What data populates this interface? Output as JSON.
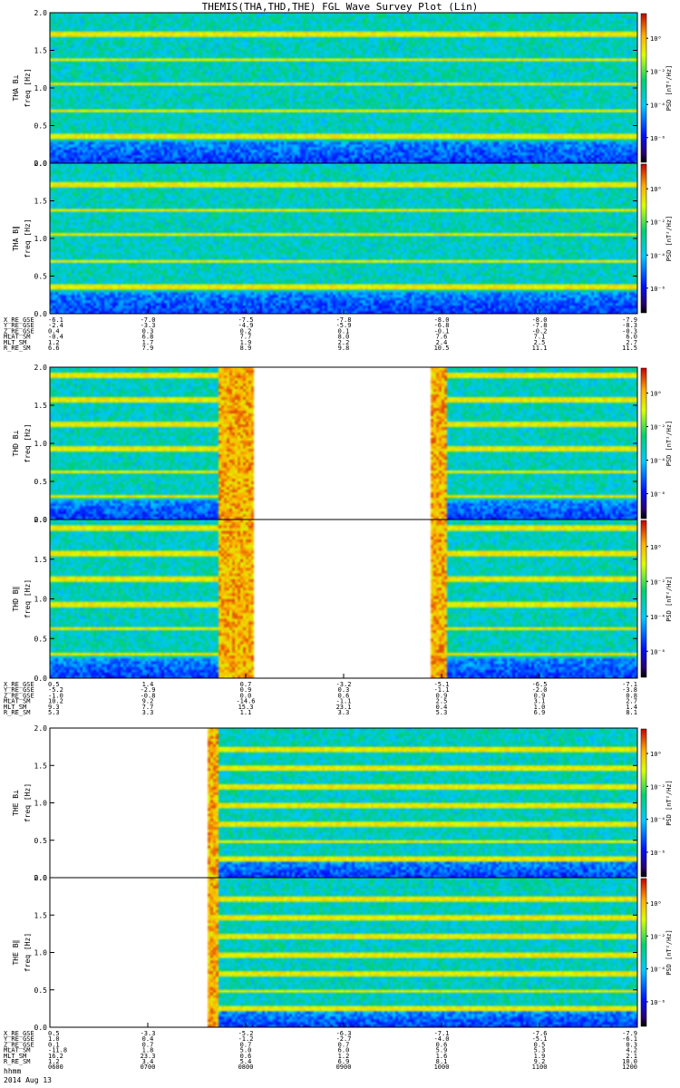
{
  "title": "THEMIS(THA,THD,THE) FGL Wave Survey Plot (Lin)",
  "colorbar_label": "PSD [nT²/Hz]",
  "colorbar_ticks": [
    "10⁰",
    "10⁻²",
    "10⁻⁴",
    "10⁻⁶"
  ],
  "freq_ticks": [
    "0.0",
    "0.5",
    "1.0",
    "1.5",
    "2.0"
  ],
  "footer": {
    "label": "hhmm",
    "date": "2014 Aug 13"
  },
  "chart_data": [
    {
      "type": "heatmap",
      "probe": "THA",
      "ylim": [
        0,
        2.0
      ],
      "panels": [
        {
          "label": "THA B⊥",
          "ylabel": "freq [Hz]",
          "bands": [
            0.35,
            0.7,
            1.05,
            1.38,
            1.72
          ],
          "lowfreq_cut": 0.3,
          "data_gaps": []
        },
        {
          "label": "THA B∥",
          "ylabel": "freq [Hz]",
          "bands": [
            0.35,
            0.7,
            1.05,
            1.38,
            1.72
          ],
          "lowfreq_cut": 0.3,
          "data_gaps": []
        }
      ],
      "ephemeris": [
        {
          "name": "X_RE_GSE",
          "values": [
            "-6.1",
            "-7.0",
            "-7.5",
            "-7.8",
            "-8.0",
            "-8.0",
            "-7.9"
          ]
        },
        {
          "name": "Y_RE_GSE",
          "values": [
            "-2.4",
            "-3.3",
            "-4.9",
            "-5.9",
            "-6.8",
            "-7.8",
            "-8.3"
          ]
        },
        {
          "name": "Z_RE_GSE",
          "values": [
            "0.4",
            "0.3",
            "0.2",
            "0.1",
            "-0.1",
            "-0.2",
            "-0.3"
          ]
        },
        {
          "name": "MLAT_SM",
          "values": [
            "-0.4",
            "6.8",
            "7.7",
            "8.0",
            "7.6",
            "7.1",
            "6.0"
          ]
        },
        {
          "name": "MLT_SM",
          "values": [
            "1.2",
            "1.7",
            "1.9",
            "2.2",
            "2.4",
            "2.5",
            "2.7"
          ]
        },
        {
          "name": "R_RE_SM",
          "values": [
            "6.6",
            "7.9",
            "8.9",
            "9.8",
            "10.5",
            "11.1",
            "11.5"
          ]
        }
      ]
    },
    {
      "type": "heatmap",
      "probe": "THD",
      "ylim": [
        0,
        2.0
      ],
      "panels": [
        {
          "label": "THD B⊥",
          "ylabel": "freq [Hz]",
          "bands": [
            0.3,
            0.62,
            0.93,
            1.25,
            1.57,
            1.9
          ],
          "lowfreq_cut": 0.25,
          "data_gaps": [
            [
              0.345,
              0.645
            ]
          ],
          "bursts": [
            [
              0.285,
              0.345
            ],
            [
              0.645,
              0.675
            ]
          ]
        },
        {
          "label": "THD B∥",
          "ylabel": "freq [Hz]",
          "bands": [
            0.3,
            0.62,
            0.93,
            1.25,
            1.57,
            1.9
          ],
          "lowfreq_cut": 0.25,
          "data_gaps": [
            [
              0.345,
              0.645
            ]
          ],
          "bursts": [
            [
              0.285,
              0.345
            ],
            [
              0.645,
              0.675
            ]
          ]
        }
      ],
      "ephemeris": [
        {
          "name": "X_RE_GSE",
          "values": [
            "0.5",
            "1.4",
            "0.7",
            "-3.2",
            "-5.1",
            "-6.5",
            "-7.1"
          ]
        },
        {
          "name": "Y_RE_GSE",
          "values": [
            "-5.2",
            "-2.9",
            "0.9",
            "0.3",
            "-1.1",
            "-2.0",
            "-3.8"
          ]
        },
        {
          "name": "Z_RE_GSE",
          "values": [
            "-1.0",
            "-0.8",
            "0.0",
            "0.6",
            "0.9",
            "0.9",
            "0.8"
          ]
        },
        {
          "name": "MLAT_SM",
          "values": [
            "10.2",
            "9.2",
            "-14.6",
            "-1.1",
            "2.5",
            "3.1",
            "2.7"
          ]
        },
        {
          "name": "MLT_SM",
          "values": [
            "9.3",
            "7.7",
            "15.3",
            "23.1",
            "0.4",
            "1.0",
            "1.4"
          ]
        },
        {
          "name": "R_RE_SM",
          "values": [
            "5.3",
            "3.3",
            "1.1",
            "3.3",
            "5.3",
            "6.9",
            "8.1"
          ]
        }
      ]
    },
    {
      "type": "heatmap",
      "probe": "THE",
      "ylim": [
        0,
        2.0
      ],
      "panels": [
        {
          "label": "THE B⊥",
          "ylabel": "freq [Hz]",
          "bands": [
            0.25,
            0.48,
            0.72,
            0.97,
            1.22,
            1.47,
            1.72
          ],
          "lowfreq_cut": 0.2,
          "data_gaps": [
            [
              0.0,
              0.265
            ]
          ],
          "bursts": [
            [
              0.265,
              0.285
            ]
          ]
        },
        {
          "label": "THE B∥",
          "ylabel": "freq [Hz]",
          "bands": [
            0.25,
            0.48,
            0.72,
            0.97,
            1.22,
            1.47,
            1.72
          ],
          "lowfreq_cut": 0.2,
          "data_gaps": [
            [
              0.0,
              0.265
            ]
          ],
          "bursts": [
            [
              0.265,
              0.285
            ]
          ]
        }
      ],
      "ephemeris": [
        {
          "name": "X_RE_GSE",
          "values": [
            "0.5",
            "-3.3",
            "-5.2",
            "-6.3",
            "-7.1",
            "-7.6",
            "-7.9"
          ]
        },
        {
          "name": "Y_RE_GSE",
          "values": [
            "1.0",
            "0.4",
            "-1.2",
            "-2.7",
            "-4.0",
            "-5.1",
            "-6.1"
          ]
        },
        {
          "name": "Z_RE_GSE",
          "values": [
            "0.1",
            "0.7",
            "0.7",
            "0.7",
            "0.6",
            "0.5",
            "0.3"
          ]
        },
        {
          "name": "MLAT_SM",
          "values": [
            "-11.8",
            "1.8",
            "5.0",
            "6.0",
            "5.9",
            "5.3",
            "4.2"
          ]
        },
        {
          "name": "MLT_SM",
          "values": [
            "16.2",
            "23.3",
            "0.6",
            "1.2",
            "1.6",
            "1.9",
            "2.1"
          ]
        },
        {
          "name": "R_RE_SM",
          "values": [
            "1.2",
            "3.4",
            "5.4",
            "6.9",
            "8.1",
            "9.2",
            "10.0"
          ]
        }
      ],
      "time_ticks": [
        "0600",
        "0700",
        "0800",
        "0900",
        "1000",
        "1100",
        "1200"
      ]
    }
  ]
}
